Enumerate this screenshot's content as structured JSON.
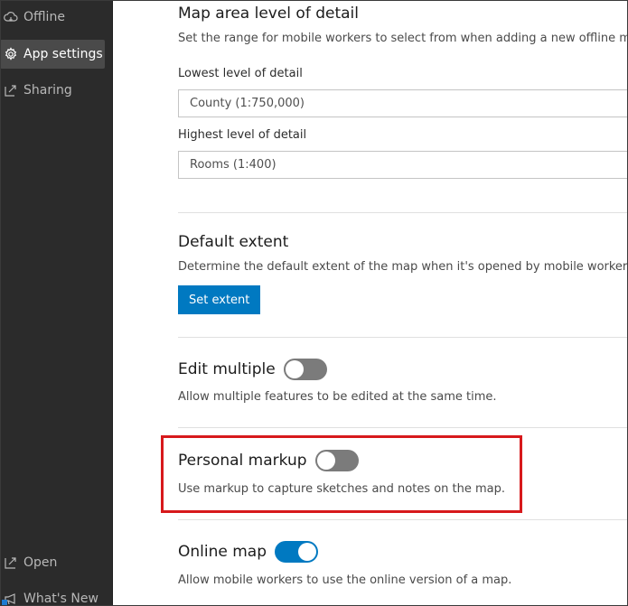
{
  "sidebar": {
    "items": [
      {
        "label": "Offline",
        "icon": "cloud-offline-icon",
        "active": false
      },
      {
        "label": "App settings",
        "icon": "gear-icon",
        "active": true
      },
      {
        "label": "Sharing",
        "icon": "share-icon",
        "active": false
      },
      {
        "label": "Open",
        "icon": "open-external-icon",
        "active": false
      },
      {
        "label": "What's New",
        "icon": "megaphone-icon",
        "active": false
      }
    ]
  },
  "sections": {
    "map_area": {
      "title": "Map area level of detail",
      "description": "Set the range for mobile workers to select from when adding a new offline map",
      "lowest_label": "Lowest level of detail",
      "lowest_value": "County (1:750,000)",
      "highest_label": "Highest level of detail",
      "highest_value": "Rooms (1:400)"
    },
    "default_extent": {
      "title": "Default extent",
      "description": "Determine the default extent of the map when it's opened by mobile workers.",
      "button_label": "Set extent"
    },
    "edit_multiple": {
      "title": "Edit multiple",
      "description": "Allow multiple features to be edited at the same time.",
      "enabled": false
    },
    "personal_markup": {
      "title": "Personal markup",
      "description": "Use markup to capture sketches and notes on the map.",
      "enabled": false
    },
    "online_map": {
      "title": "Online map",
      "description": "Allow mobile workers to use the online version of a map.",
      "enabled": true
    }
  },
  "colors": {
    "accent": "#0079c1",
    "highlight": "#d7191c",
    "sidebar_bg": "#2b2b2b"
  }
}
